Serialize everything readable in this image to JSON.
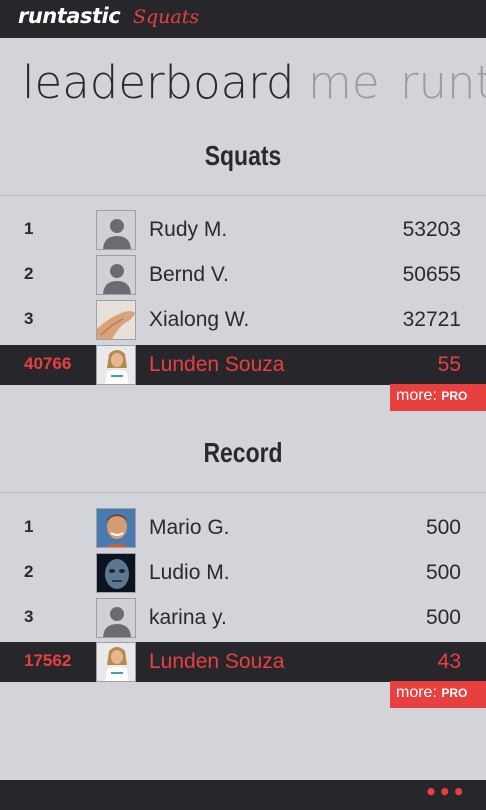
{
  "app": {
    "brand": "runtastic",
    "product": "Squats"
  },
  "pivots": [
    "leaderboard",
    "me",
    "runt"
  ],
  "sections": [
    {
      "title": "Squats",
      "rows": [
        {
          "rank": "1",
          "name": "Rudy M.",
          "score": "53203",
          "avatar": "default-avatar-icon"
        },
        {
          "rank": "2",
          "name": "Bernd V.",
          "score": "50655",
          "avatar": "default-avatar-icon"
        },
        {
          "rank": "3",
          "name": "Xialong W.",
          "score": "32721",
          "avatar": "hand-photo"
        }
      ],
      "me": {
        "rank": "40766",
        "name": "Lunden Souza",
        "score": "55"
      },
      "more_label": "more: ",
      "pro_label": "PRO"
    },
    {
      "title": "Record",
      "rows": [
        {
          "rank": "1",
          "name": "Mario G.",
          "score": "500",
          "avatar": "man-photo"
        },
        {
          "rank": "2",
          "name": "Ludio M.",
          "score": "500",
          "avatar": "dark-face-photo"
        },
        {
          "rank": "3",
          "name": "karina y.",
          "score": "500",
          "avatar": "default-avatar-icon"
        }
      ],
      "me": {
        "rank": "17562",
        "name": "Lunden Souza",
        "score": "43"
      },
      "more_label": "more: ",
      "pro_label": "PRO"
    }
  ],
  "app_bar": {
    "menu_icon": "ellipsis-icon",
    "menu_glyph": "•••"
  },
  "colors": {
    "accent": "#e8403f",
    "bar": "#26262b",
    "background": "#d3d4d9"
  }
}
